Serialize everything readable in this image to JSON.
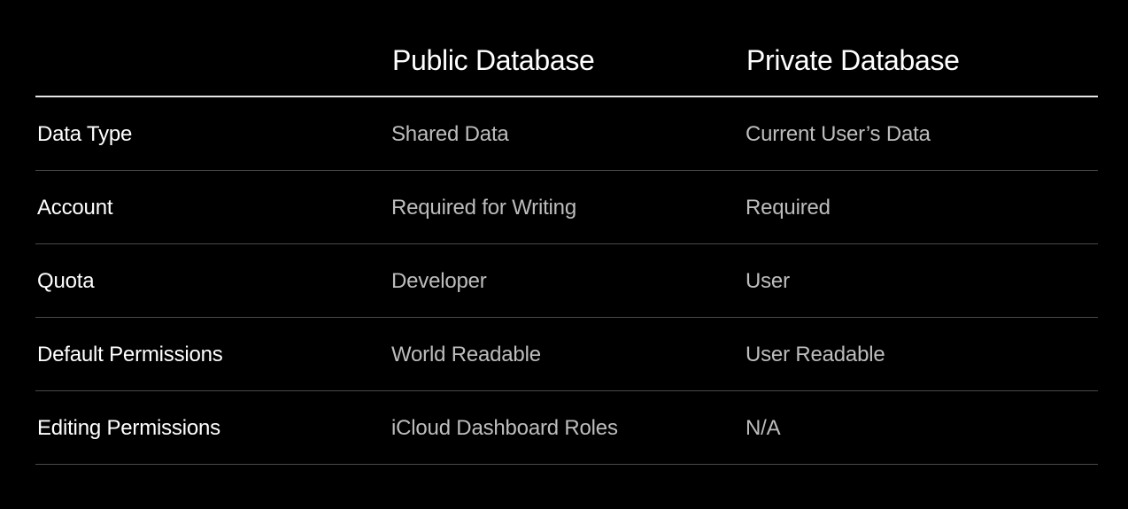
{
  "table": {
    "columns": {
      "public": "Public Database",
      "private": "Private Database"
    },
    "rows": [
      {
        "label": "Data Type",
        "public": "Shared Data",
        "private": "Current User’s Data"
      },
      {
        "label": "Account",
        "public": "Required for Writing",
        "private": "Required"
      },
      {
        "label": "Quota",
        "public": "Developer",
        "private": "User"
      },
      {
        "label": "Default Permissions",
        "public": "World Readable",
        "private": "User Readable"
      },
      {
        "label": "Editing Permissions",
        "public": "iCloud Dashboard Roles",
        "private": "N/A"
      }
    ]
  },
  "colors": {
    "background": "#000000",
    "heading_text": "#ffffff",
    "label_text": "#ffffff",
    "value_text": "#bdbdbd",
    "header_rule": "#e6e6e6",
    "row_rule": "#4a4a4a"
  }
}
